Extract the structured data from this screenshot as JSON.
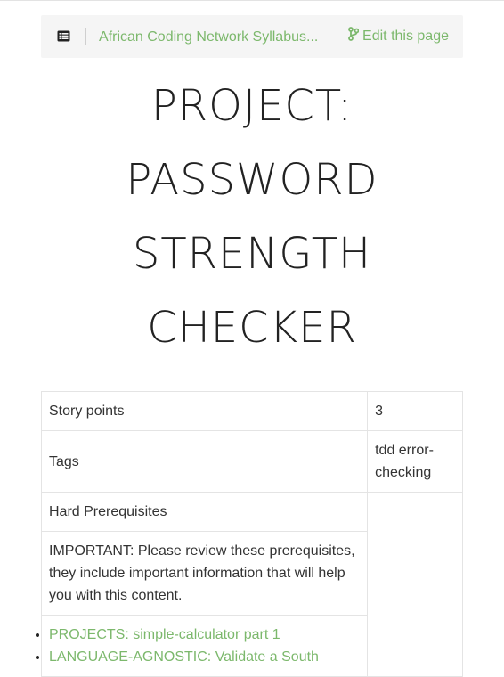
{
  "topbar": {
    "breadcrumb": "African Coding Network Syllabus...",
    "edit_label": "Edit this page",
    "toc_icon": "list-alt-icon",
    "edit_icon": "code-branch-icon"
  },
  "page": {
    "title_lines": [
      "PROJECT:",
      "PASSWORD",
      "STRENGTH",
      "CHECKER"
    ]
  },
  "meta_table": {
    "rows": [
      {
        "key": "Story points",
        "value": "3"
      },
      {
        "key": "Tags",
        "value": "tdd error-checking"
      },
      {
        "key": "Hard Prerequisites",
        "value": ""
      }
    ],
    "important_note": "IMPORTANT: Please review these prerequisites, they include important information that will help you with this content.",
    "prerequisites": [
      "PROJECTS: simple-calculator part 1",
      "LANGUAGE-AGNOSTIC: Validate a South"
    ]
  },
  "colors": {
    "link": "#7cb86c",
    "topbar_bg": "#f5f5f5",
    "border": "#e4e4e4",
    "text": "#333333"
  }
}
